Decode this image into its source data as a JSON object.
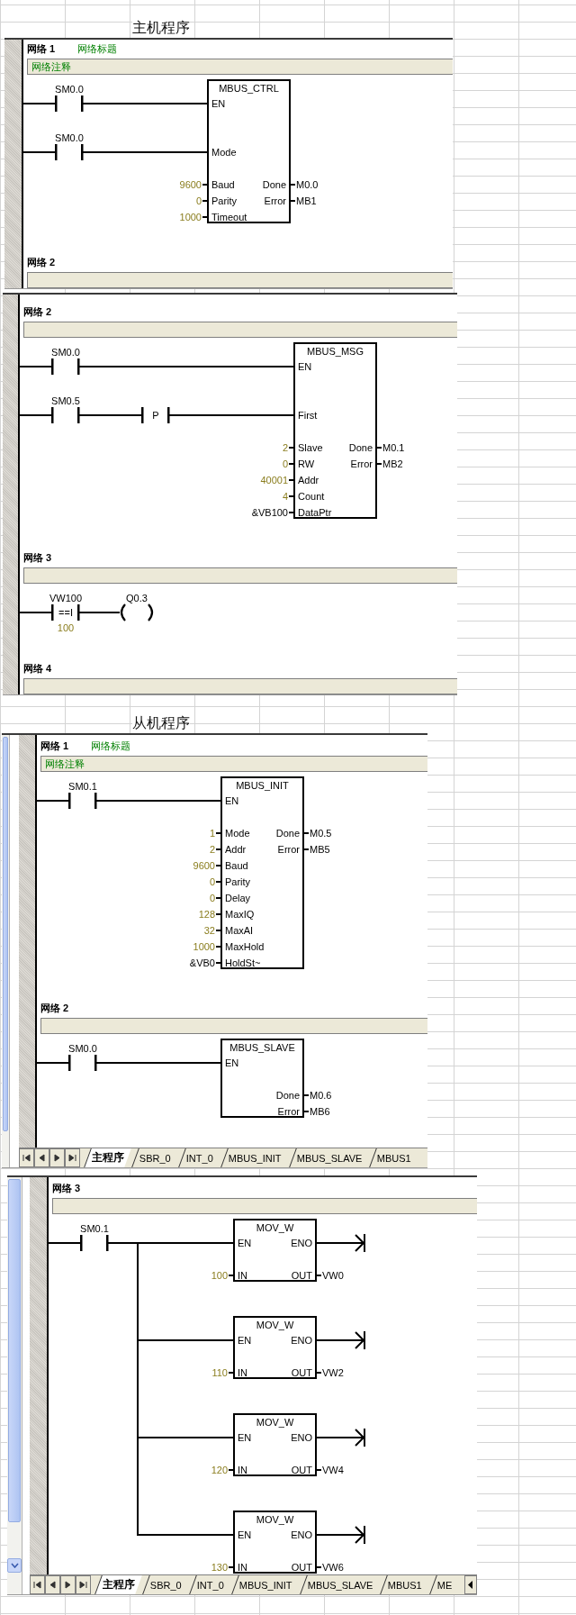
{
  "sections": [
    {
      "label": "主机程序",
      "panels": [
        {
          "networks": [
            {
              "title": "网络 1",
              "comment_title": "网络标题",
              "comment": "网络注释",
              "diagram": {
                "kind": "box",
                "rungs": [
                  {
                    "elements": [
                      {
                        "kind": "contact",
                        "label": "SM0.0"
                      }
                    ],
                    "pin": "EN"
                  },
                  {
                    "elements": [
                      {
                        "kind": "contact",
                        "label": "SM0.0"
                      }
                    ],
                    "pin": "Mode"
                  }
                ],
                "box": {
                  "name": "MBUS_CTRL",
                  "inputs": [
                    {
                      "value": "9600",
                      "pin": "Baud",
                      "kind": "constant"
                    },
                    {
                      "value": "0",
                      "pin": "Parity",
                      "kind": "constant"
                    },
                    {
                      "value": "1000",
                      "pin": "Timeout",
                      "kind": "constant"
                    }
                  ],
                  "outputs": [
                    {
                      "pin": "Done",
                      "value": "M0.0"
                    },
                    {
                      "pin": "Error",
                      "value": "MB1"
                    }
                  ]
                }
              }
            },
            {
              "title": "网络 2"
            }
          ]
        },
        {
          "networks": [
            {
              "title": "网络 2",
              "diagram": {
                "kind": "box",
                "rungs": [
                  {
                    "elements": [
                      {
                        "kind": "contact",
                        "label": "SM0.0"
                      }
                    ],
                    "pin": "EN"
                  },
                  {
                    "elements": [
                      {
                        "kind": "contact",
                        "label": "SM0.5"
                      },
                      {
                        "kind": "edge",
                        "symbol": "P"
                      }
                    ],
                    "pin": "First"
                  }
                ],
                "box": {
                  "name": "MBUS_MSG",
                  "inputs": [
                    {
                      "value": "2",
                      "pin": "Slave",
                      "kind": "constant"
                    },
                    {
                      "value": "0",
                      "pin": "RW",
                      "kind": "constant"
                    },
                    {
                      "value": "40001",
                      "pin": "Addr",
                      "kind": "constant"
                    },
                    {
                      "value": "4",
                      "pin": "Count",
                      "kind": "constant"
                    },
                    {
                      "value": "&VB100",
                      "pin": "DataPtr",
                      "kind": "address"
                    }
                  ],
                  "outputs": [
                    {
                      "pin": "Done",
                      "value": "M0.1"
                    },
                    {
                      "pin": "Error",
                      "value": "MB2"
                    }
                  ]
                }
              }
            },
            {
              "title": "网络 3",
              "diagram": {
                "kind": "compare",
                "contact": {
                  "label": "VW100",
                  "operator": "==I",
                  "operand": "100"
                },
                "coil": {
                  "label": "Q0.3"
                }
              }
            },
            {
              "title": "网络 4"
            }
          ]
        }
      ]
    },
    {
      "label": "从机程序",
      "panels": [
        {
          "networks": [
            {
              "title": "网络 1",
              "comment_title": "网络标题",
              "comment": "网络注释",
              "diagram": {
                "kind": "box",
                "rungs": [
                  {
                    "elements": [
                      {
                        "kind": "contact",
                        "label": "SM0.1"
                      }
                    ],
                    "pin": "EN"
                  }
                ],
                "box": {
                  "name": "MBUS_INIT",
                  "inputs": [
                    {
                      "value": "1",
                      "pin": "Mode",
                      "kind": "constant"
                    },
                    {
                      "value": "2",
                      "pin": "Addr",
                      "kind": "constant"
                    },
                    {
                      "value": "9600",
                      "pin": "Baud",
                      "kind": "constant"
                    },
                    {
                      "value": "0",
                      "pin": "Parity",
                      "kind": "constant"
                    },
                    {
                      "value": "0",
                      "pin": "Delay",
                      "kind": "constant"
                    },
                    {
                      "value": "128",
                      "pin": "MaxIQ",
                      "kind": "constant"
                    },
                    {
                      "value": "32",
                      "pin": "MaxAI",
                      "kind": "constant"
                    },
                    {
                      "value": "1000",
                      "pin": "MaxHold",
                      "kind": "constant"
                    },
                    {
                      "value": "&VB0",
                      "pin": "HoldSt~",
                      "kind": "address"
                    }
                  ],
                  "outputs": [
                    {
                      "pin": "Done",
                      "value": "M0.5"
                    },
                    {
                      "pin": "Error",
                      "value": "MB5"
                    }
                  ]
                }
              }
            },
            {
              "title": "网络 2",
              "diagram": {
                "kind": "box",
                "rungs": [
                  {
                    "elements": [
                      {
                        "kind": "contact",
                        "label": "SM0.0"
                      }
                    ],
                    "pin": "EN"
                  }
                ],
                "box": {
                  "name": "MBUS_SLAVE",
                  "outputs": [
                    {
                      "pin": "Done",
                      "value": "M0.6"
                    },
                    {
                      "pin": "Error",
                      "value": "MB6"
                    }
                  ]
                }
              }
            }
          ],
          "tabs": [
            {
              "label": "主程序",
              "selected": true
            },
            {
              "label": "SBR_0",
              "selected": false
            },
            {
              "label": "INT_0",
              "selected": false
            },
            {
              "label": "MBUS_INIT",
              "selected": false
            },
            {
              "label": "MBUS_SLAVE",
              "selected": false
            },
            {
              "label": "MBUS1",
              "selected": false
            }
          ]
        },
        {
          "networks": [
            {
              "title": "网络 3",
              "diagram": {
                "kind": "branch",
                "contact": {
                  "label": "SM0.1"
                },
                "boxes": [
                  {
                    "name": "MOV_W",
                    "en": "EN",
                    "eno": "ENO",
                    "inputs": [
                      {
                        "value": "100",
                        "pin": "IN",
                        "kind": "constant"
                      }
                    ],
                    "outputs": [
                      {
                        "pin": "OUT",
                        "value": "VW0"
                      }
                    ]
                  },
                  {
                    "name": "MOV_W",
                    "en": "EN",
                    "eno": "ENO",
                    "inputs": [
                      {
                        "value": "110",
                        "pin": "IN",
                        "kind": "constant"
                      }
                    ],
                    "outputs": [
                      {
                        "pin": "OUT",
                        "value": "VW2"
                      }
                    ]
                  },
                  {
                    "name": "MOV_W",
                    "en": "EN",
                    "eno": "ENO",
                    "inputs": [
                      {
                        "value": "120",
                        "pin": "IN",
                        "kind": "constant"
                      }
                    ],
                    "outputs": [
                      {
                        "pin": "OUT",
                        "value": "VW4"
                      }
                    ]
                  },
                  {
                    "name": "MOV_W",
                    "en": "EN",
                    "eno": "ENO",
                    "inputs": [
                      {
                        "value": "130",
                        "pin": "IN",
                        "kind": "constant"
                      }
                    ],
                    "outputs": [
                      {
                        "pin": "OUT",
                        "value": "VW6"
                      }
                    ]
                  }
                ]
              }
            }
          ],
          "tabs": [
            {
              "label": "主程序",
              "selected": true
            },
            {
              "label": "SBR_0",
              "selected": false
            },
            {
              "label": "INT_0",
              "selected": false
            },
            {
              "label": "MBUS_INIT",
              "selected": false
            },
            {
              "label": "MBUS_SLAVE",
              "selected": false
            },
            {
              "label": "MBUS1",
              "selected": false
            },
            {
              "label": "ME",
              "selected": false
            }
          ]
        }
      ]
    }
  ]
}
